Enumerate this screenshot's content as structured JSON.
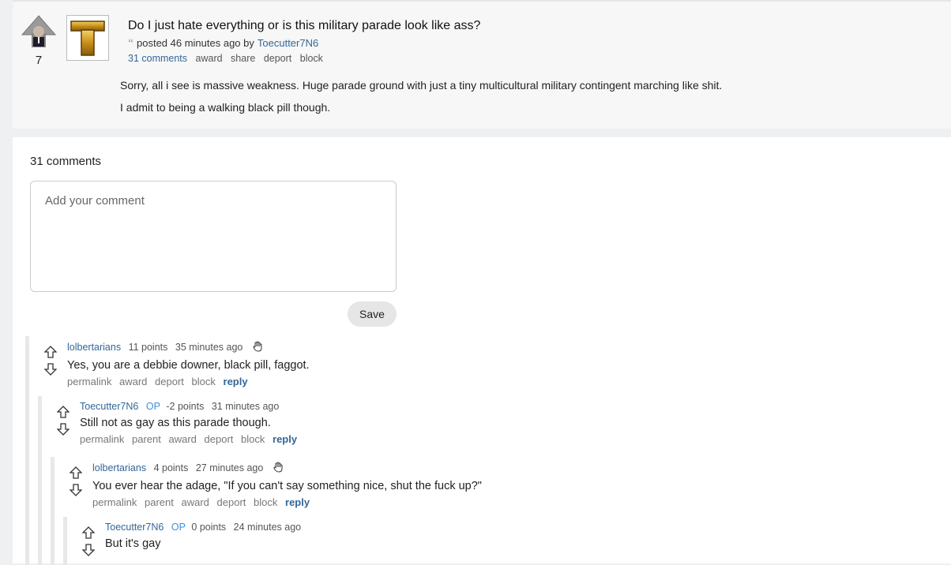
{
  "post": {
    "score": "7",
    "thumb_letter": "T",
    "title": "Do I just hate everything or is this military parade look like ass?",
    "posted_text": "posted 46 minutes ago by",
    "author": "Toecutter7N6",
    "actions": [
      "31 comments",
      "award",
      "share",
      "deport",
      "block"
    ],
    "body": [
      "Sorry, all i see is massive weakness. Huge parade ground with just a tiny multicultural military contingent marching like shit.",
      "I admit to being a walking black pill though."
    ]
  },
  "comments_section": {
    "count_label": "31 comments",
    "placeholder": "Add your comment",
    "save_label": "Save"
  },
  "comments": [
    {
      "author": "lolbertarians",
      "op": "",
      "points": "11 points",
      "time": "35 minutes ago",
      "text": "Yes, you are a debbie downer, black pill, faggot.",
      "actions": [
        "permalink",
        "award",
        "deport",
        "block"
      ],
      "reply": "reply"
    },
    {
      "author": "Toecutter7N6",
      "op": "OP",
      "points": "-2 points",
      "time": "31 minutes ago",
      "text": "Still not as gay as this parade though.",
      "actions": [
        "permalink",
        "parent",
        "award",
        "deport",
        "block"
      ],
      "reply": "reply"
    },
    {
      "author": "lolbertarians",
      "op": "",
      "points": "4 points",
      "time": "27 minutes ago",
      "text": "You ever hear the adage, \"If you can't say something nice, shut the fuck up?\"",
      "actions": [
        "permalink",
        "parent",
        "award",
        "deport",
        "block"
      ],
      "reply": "reply"
    },
    {
      "author": "Toecutter7N6",
      "op": "OP",
      "points": "0 points",
      "time": "24 minutes ago",
      "text": "But it's gay",
      "actions": [],
      "reply": ""
    }
  ]
}
